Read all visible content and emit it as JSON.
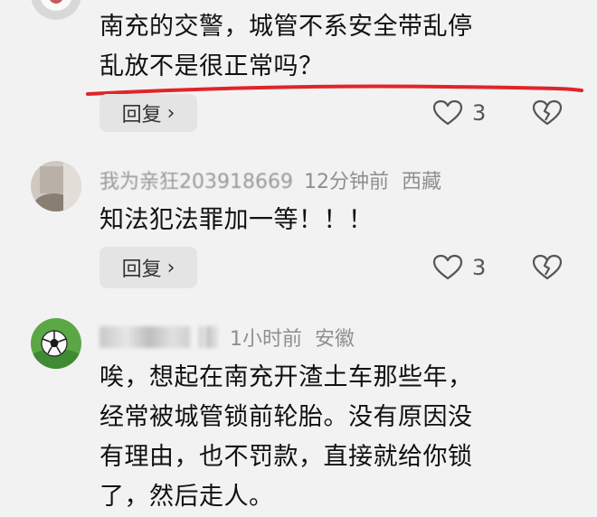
{
  "comments": [
    {
      "text_lines": [
        "南充的交警，城管不系安全带乱停",
        "乱放不是很正常吗？"
      ],
      "reply_label": "回复",
      "like_count": "3"
    },
    {
      "username": "我为亲狂203918669",
      "time": "12分钟前",
      "location": "西藏",
      "text_lines": [
        "知法犯法罪加一等！！！"
      ],
      "reply_label": "回复",
      "like_count": "3"
    },
    {
      "time": "1小时前",
      "location": "安徽",
      "text_lines": [
        "唉，想起在南充开渣土车那些年，",
        "经常被城管锁前轮胎。没有原因没",
        "有理由，也不罚款，直接就给你锁",
        "了，然后走人。"
      ]
    }
  ],
  "colors": {
    "background": "#f2f2f2",
    "annotation_line": "#e0242a",
    "reply_button_bg": "#e4e4e4",
    "meta_text": "#8f8f8f"
  },
  "icons": {
    "chevron": "›",
    "like": "heart-outline-icon",
    "dislike": "broken-heart-icon",
    "avatar_3": "soccer-ball-icon"
  }
}
